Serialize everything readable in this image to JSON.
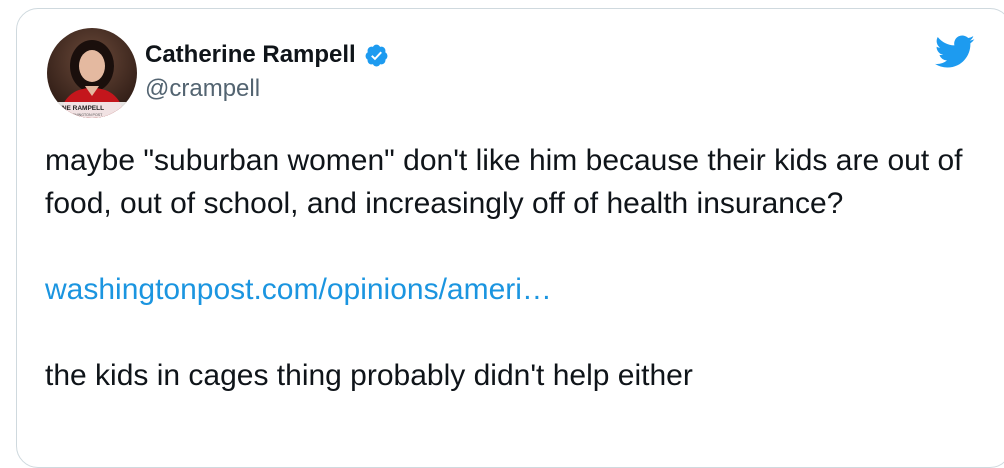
{
  "author": {
    "name": "Catherine Rampell",
    "handle": "@crampell",
    "verified": true,
    "avatar_caption": "ERINE RAMPELL",
    "avatar_subcaption": "WASHINGTON POST"
  },
  "tweet": {
    "text_1": "maybe \"suburban women\" don't like him because their kids are out of food, out of school, and increasingly off of health insurance?",
    "link": "washingtonpost.com/opinions/ameri…",
    "text_2": "the kids in cages thing probably didn't help either"
  },
  "icons": {
    "verified": "verified-badge-icon",
    "brand": "twitter-bird-icon"
  },
  "colors": {
    "link": "#1b95e0",
    "verified": "#1d9bf0",
    "brand": "#1d9bf0",
    "text": "#0f1419",
    "handle": "#536471"
  }
}
